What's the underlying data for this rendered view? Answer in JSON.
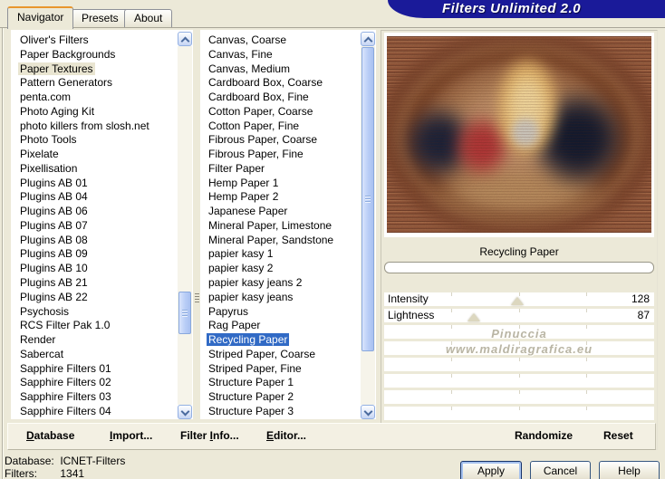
{
  "banner": {
    "title": "Filters Unlimited 2.0"
  },
  "tabs": {
    "navigator": "Navigator",
    "presets": "Presets",
    "about": "About"
  },
  "category_list": {
    "selected_index": 2,
    "items": [
      "Oliver's Filters",
      "Paper Backgrounds",
      "Paper Textures",
      "Pattern Generators",
      "penta.com",
      "Photo Aging Kit",
      "photo killers from slosh.net",
      "Photo Tools",
      "Pixelate",
      "Pixellisation",
      "Plugins AB 01",
      "Plugins AB 04",
      "Plugins AB 06",
      "Plugins AB 07",
      "Plugins AB 08",
      "Plugins AB 09",
      "Plugins AB 10",
      "Plugins AB 21",
      "Plugins AB 22",
      "Psychosis",
      "RCS Filter Pak 1.0",
      "Render",
      "Sabercat",
      "Sapphire Filters 01",
      "Sapphire Filters 02",
      "Sapphire Filters 03",
      "Sapphire Filters 04"
    ]
  },
  "texture_list": {
    "selected_index": 21,
    "items": [
      "Canvas, Coarse",
      "Canvas, Fine",
      "Canvas, Medium",
      "Cardboard Box, Coarse",
      "Cardboard Box, Fine",
      "Cotton Paper, Coarse",
      "Cotton Paper, Fine",
      "Fibrous Paper, Coarse",
      "Fibrous Paper, Fine",
      "Filter Paper",
      "Hemp Paper 1",
      "Hemp Paper 2",
      "Japanese Paper",
      "Mineral Paper, Limestone",
      "Mineral Paper, Sandstone",
      "papier kasy 1",
      "papier kasy 2",
      "papier kasy jeans 2",
      "papier kasy jeans",
      "Papyrus",
      "Rag Paper",
      "Recycling Paper",
      "Striped Paper, Coarse",
      "Striped Paper, Fine",
      "Structure Paper 1",
      "Structure Paper 2",
      "Structure Paper 3"
    ]
  },
  "preview": {
    "caption": "Recycling Paper",
    "watermark_line1": "Pinuccia",
    "watermark_line2": "www.maldiragrafica.eu"
  },
  "sliders": {
    "intensity": {
      "label": "Intensity",
      "value": "128",
      "thumb_style": "left:49.3%"
    },
    "lightness": {
      "label": "Lightness",
      "value": "87",
      "thumb_style": "left:33.2%"
    }
  },
  "toolbar": {
    "database": {
      "pre": "",
      "key": "D",
      "post": "atabase"
    },
    "import": {
      "pre": "",
      "key": "I",
      "post": "mport..."
    },
    "filter_info": {
      "pre": "Filter ",
      "key": "I",
      "post": "nfo..."
    },
    "editor": {
      "pre": "",
      "key": "E",
      "post": "ditor..."
    },
    "randomize": "Randomize",
    "reset": "Reset"
  },
  "status": {
    "database_label": "Database:",
    "database_value": "ICNET-Filters",
    "filters_label": "Filters:",
    "filters_value": "1341"
  },
  "buttons": {
    "apply": "Apply",
    "cancel": "Cancel",
    "help": "Help"
  },
  "colors": {
    "selection_blue": "#316ac5",
    "banner_blue": "#1a1a99",
    "tab_accent_orange": "#e8962e",
    "dialog_bg": "#ece9d8"
  }
}
